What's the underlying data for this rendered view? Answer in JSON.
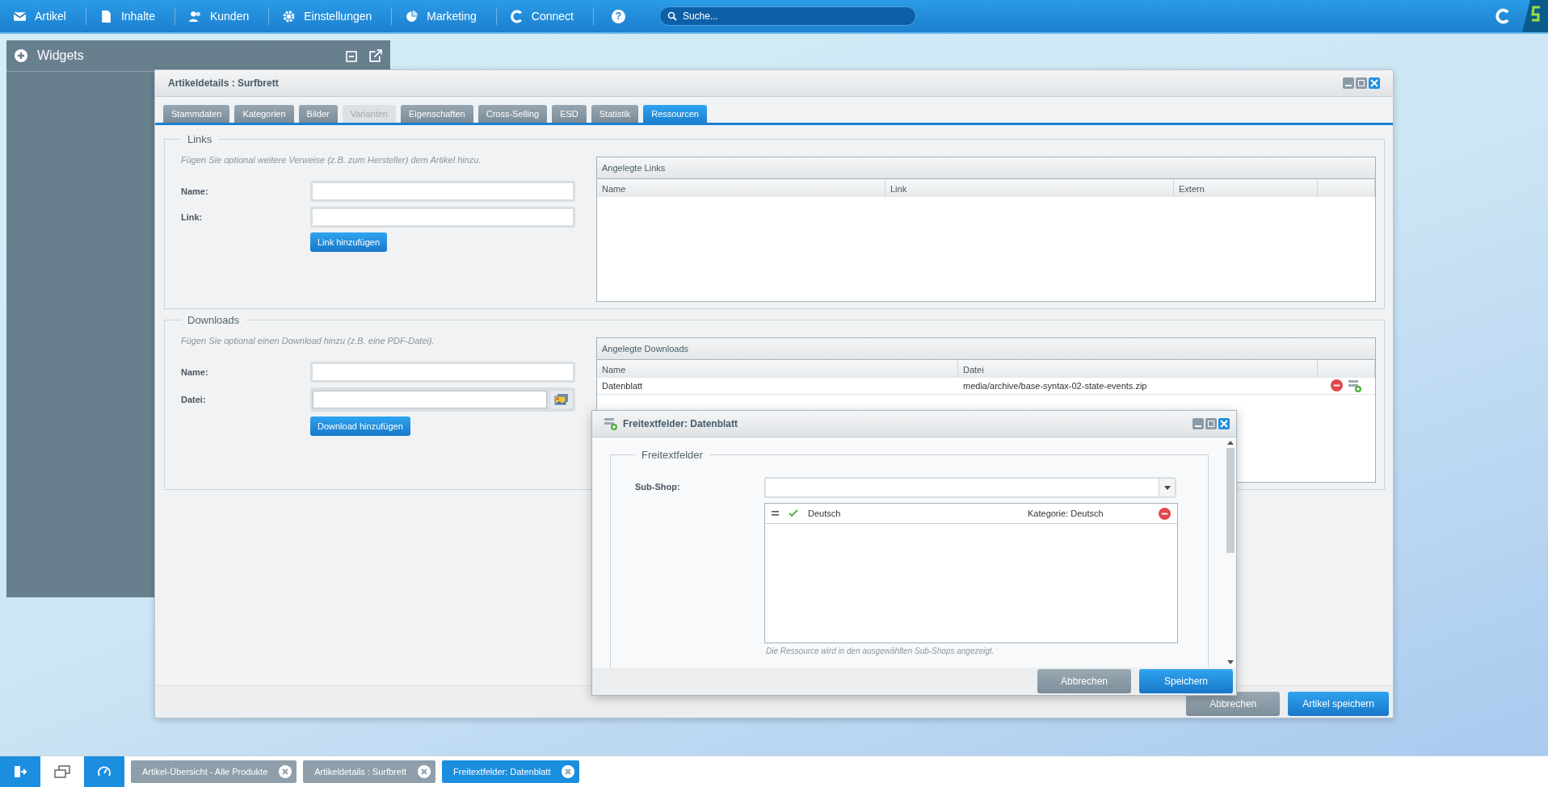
{
  "top_menu": {
    "items": [
      {
        "label": "Artikel"
      },
      {
        "label": "Inhalte"
      },
      {
        "label": "Kunden"
      },
      {
        "label": "Einstellungen"
      },
      {
        "label": "Marketing"
      },
      {
        "label": "Connect"
      }
    ]
  },
  "help_icon": "?",
  "search": {
    "placeholder": "Suche..."
  },
  "widgets_panel": {
    "title": "Widgets"
  },
  "window": {
    "title": "Artikeldetails : Surfbrett",
    "tabs": [
      {
        "label": "Stammdaten",
        "selected": false,
        "disabled": false
      },
      {
        "label": "Kategorien",
        "selected": false,
        "disabled": false
      },
      {
        "label": "Bilder",
        "selected": false,
        "disabled": false
      },
      {
        "label": "Varianten",
        "selected": false,
        "disabled": true
      },
      {
        "label": "Eigenschaften",
        "selected": false,
        "disabled": false
      },
      {
        "label": "Cross-Selling",
        "selected": false,
        "disabled": false
      },
      {
        "label": "ESD",
        "selected": false,
        "disabled": false
      },
      {
        "label": "Statistik",
        "selected": false,
        "disabled": false
      },
      {
        "label": "Ressourcen",
        "selected": true,
        "disabled": false
      }
    ],
    "sections": [
      {
        "legend": "Links",
        "hint": "Fügen Sie optional weitere Verweise (z.B. zum Hersteller) dem Artikel hinzu.",
        "fields": [
          {
            "label": "Name:",
            "kind": "text"
          },
          {
            "label": "Link:",
            "kind": "text"
          }
        ],
        "button": "Link hinzufügen",
        "grid": {
          "title": "Angelegte Links",
          "columns": [
            "Name",
            "Link",
            "Extern"
          ]
        }
      },
      {
        "legend": "Downloads",
        "hint": "Fügen Sie optional einen Download hinzu (z.B. eine PDF-Datei).",
        "fields": [
          {
            "label": "Name:",
            "kind": "text"
          },
          {
            "label": "Datei:",
            "kind": "file"
          }
        ],
        "button": "Download hinzufügen",
        "grid": {
          "title": "Angelegte Downloads",
          "columns": [
            "Name",
            "Datei"
          ],
          "rows": [
            {
              "cells": [
                "Datenblatt",
                "media/archive/base-syntax-02-state-events.zip"
              ]
            }
          ]
        }
      }
    ],
    "buttons": [
      {
        "label": "Abbrechen",
        "kind": "secondary"
      },
      {
        "label": "Artikel speichern",
        "kind": "primary"
      }
    ]
  },
  "dialog": {
    "title": "Freitextfelder: Datenblatt",
    "legend": "Freitextfelder",
    "field_label": "Sub-Shop:",
    "shops": [
      {
        "name": "Deutsch",
        "category": "Kategorie: Deutsch",
        "checked": true
      }
    ],
    "hint": "Die Ressource wird in den ausgewählten Sub-Shops angezeigt.",
    "buttons": [
      {
        "label": "Abbrechen",
        "kind": "secondary"
      },
      {
        "label": "Speichern",
        "kind": "primary"
      }
    ]
  },
  "taskbar": {
    "items": [
      {
        "label": "Artikel-Übersicht - Alle Produkte",
        "selected": false
      },
      {
        "label": "Artikeldetails : Surfbrett",
        "selected": false
      },
      {
        "label": "Freitextfelder: Datenblatt",
        "selected": true
      }
    ]
  }
}
